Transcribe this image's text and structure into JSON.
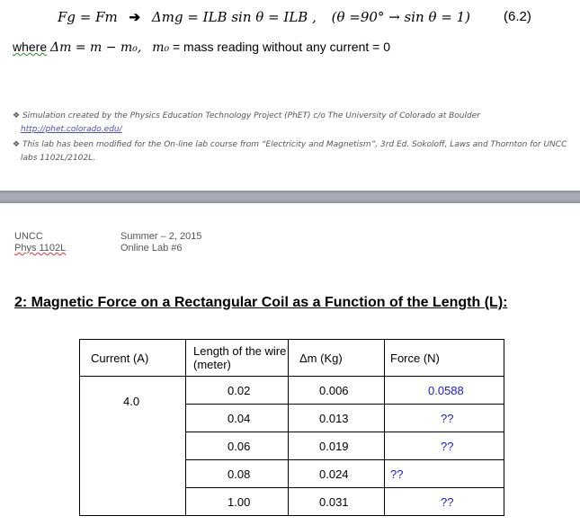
{
  "equation": {
    "lhs": "Fg = Fm",
    "arrow": "➔",
    "middle": "Δmg = ILB sin θ = ILB ,",
    "condition": "(θ =90° → sin θ = 1)",
    "number": "(6.2)"
  },
  "where_line": {
    "where": "where",
    "formula": "Δm = m − m₀,",
    "m0": "m₀",
    "rest": " = mass reading without any current = 0"
  },
  "notes": [
    {
      "bullet": "❖",
      "text": "Simulation created by the Physics Education Technology Project (PhET) c/o The University of Colorado at Boulder",
      "link": "http://phet.colorado.edu/"
    },
    {
      "bullet": "❖",
      "text": "This lab has been modified for the On-line lab course from “Electricity and Magnetism”, 3rd Ed. Sokoloff, Laws and Thornton for UNCC",
      "text2": "labs 1102L/2102L."
    }
  ],
  "header": {
    "school": "UNCC",
    "course": "Phys 1102L",
    "term": "Summer – 2, 2015",
    "lab": "Online Lab #6"
  },
  "section_title": "2: Magnetic Force on a Rectangular Coil as a Function of the Length (L):",
  "table": {
    "headers": [
      "Current (A)",
      "Length of the wire (meter)",
      "Δm (Kg)",
      "Force (N)"
    ],
    "current": "4.0",
    "rows": [
      {
        "length": "0.02",
        "dm": "0.006",
        "force": "0.0588"
      },
      {
        "length": "0.04",
        "dm": "0.013",
        "force": "??"
      },
      {
        "length": "0.06",
        "dm": "0.019",
        "force": "??"
      },
      {
        "length": "0.08",
        "dm": "0.024",
        "force": "??"
      },
      {
        "length": "1.00",
        "dm": "0.031",
        "force": "??"
      }
    ]
  }
}
